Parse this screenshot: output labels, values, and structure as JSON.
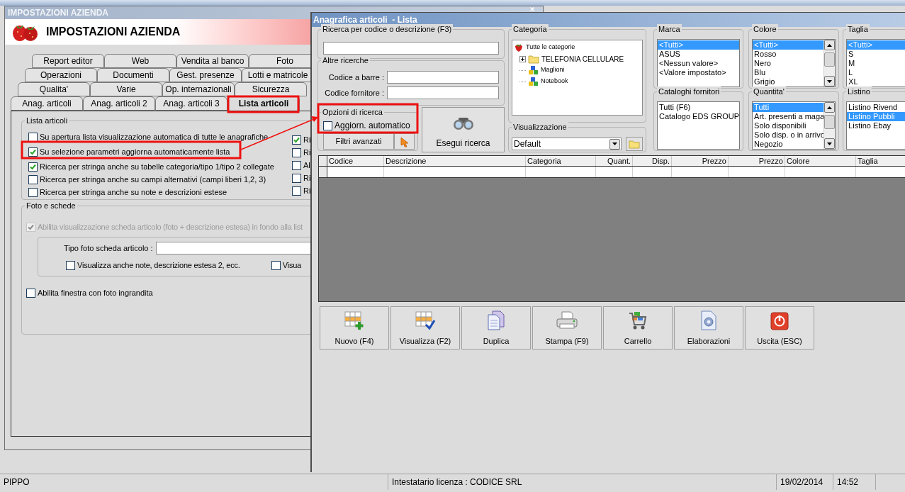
{
  "settings_window": {
    "title": "IMPOSTAZIONI AZIENDA",
    "header_title": "IMPOSTAZIONI AZIENDA",
    "tab_rows": [
      [
        {
          "label": "Report editor",
          "selected": false
        },
        {
          "label": "Web",
          "selected": false
        },
        {
          "label": "Vendita al banco",
          "selected": false
        },
        {
          "label": "Foto",
          "selected": false
        }
      ],
      [
        {
          "label": "Operazioni",
          "selected": false
        },
        {
          "label": "Documenti",
          "selected": false
        },
        {
          "label": "Gest. presenze",
          "selected": false
        },
        {
          "label": "Lotti e matricole",
          "selected": false
        }
      ],
      [
        {
          "label": "Qualita'",
          "selected": false
        },
        {
          "label": "Varie",
          "selected": false
        },
        {
          "label": "Op. internazionali",
          "selected": false
        },
        {
          "label": "Sicurezza",
          "selected": false
        }
      ],
      [
        {
          "label": "Anag. articoli",
          "selected": false
        },
        {
          "label": "Anag. articoli 2",
          "selected": false
        },
        {
          "label": "Anag. articoli 3",
          "selected": false
        },
        {
          "label": "Lista articoli",
          "selected": true
        }
      ]
    ],
    "list_group": {
      "legend": "Lista articoli",
      "options": [
        {
          "label": "Su apertura lista visualizzazione automatica di tutte le anagrafiche",
          "checked": false
        },
        {
          "label": "Su selezione parametri aggiorna automaticamente lista",
          "checked": true
        },
        {
          "label": "Ricerca per stringa anche su tabelle categoria/tipo 1/tipo 2 collegate",
          "checked": true
        },
        {
          "label": "Ricerca per stringa anche su campi alternativi (campi liberi 1,2, 3)",
          "checked": false
        },
        {
          "label": "Ricerca per stringa anche su note e descrizioni estese",
          "checked": false
        }
      ],
      "side_options": [
        {
          "label": "Ri",
          "checked": true
        },
        {
          "label": "Ri",
          "checked": false
        },
        {
          "label": "Al",
          "checked": false
        },
        {
          "label": "Ri",
          "checked": false
        },
        {
          "label": "Ri",
          "checked": false
        }
      ]
    },
    "photo_group": {
      "legend": "Foto e schede",
      "option": {
        "label": "Abilita visualizzazione scheda articolo (foto + descrizione estesa) in fondo alla list",
        "checked": true,
        "disabled": true
      },
      "photo_type": {
        "label": "Tipo foto scheda articolo :"
      },
      "sub_options": [
        {
          "label": "Visualizza anche note, descrizione estesa 2, ecc.",
          "checked": false
        },
        {
          "label": "Visua",
          "checked": false
        }
      ],
      "enlarged_photo_option": {
        "label": "Abilita finestra con foto ingrandita",
        "checked": false
      }
    }
  },
  "list_window": {
    "title": "Anagrafica articoli  - Lista",
    "search_group": {
      "legend": "Ricerca per codice o descrizione (F3)"
    },
    "other_search": {
      "legend": "Altre ricerche",
      "fields": [
        {
          "label": "Codice a barre :"
        },
        {
          "label": "Codice fornitore :"
        }
      ]
    },
    "options_group": {
      "legend": "Opzioni di ricerca",
      "auto_update": {
        "label": "Aggiorn. automatico",
        "checked": false
      },
      "advanced_button": "Filtri avanzati"
    },
    "search_button": "Esegui ricerca",
    "category": {
      "legend": "Categoria",
      "tree": [
        {
          "label": "Tutte le categorie",
          "kind": "root",
          "children": [
            {
              "label": "TELEFONIA CELLULARE",
              "kind": "folder",
              "expanded": false
            },
            {
              "label": "Maglioni",
              "kind": "item"
            },
            {
              "label": "Notebook",
              "kind": "item"
            }
          ]
        }
      ]
    },
    "view": {
      "legend": "Visualizzazione",
      "value": "Default"
    },
    "filter_columns": [
      [
        {
          "legend": "Marca",
          "scrollbar": false,
          "items": [
            {
              "text": "<Tutti>",
              "selected": true
            },
            {
              "text": "ASUS",
              "selected": false
            },
            {
              "text": "<Nessun valore>",
              "selected": false
            },
            {
              "text": "<Valore impostato>",
              "selected": false
            }
          ]
        },
        {
          "legend": "Cataloghi fornitori",
          "scrollbar": false,
          "items": [
            {
              "text": "Tutti (F6)",
              "selected": false
            },
            {
              "text": "Catalogo EDS GROUP",
              "selected": false
            }
          ]
        }
      ],
      [
        {
          "legend": "Colore",
          "scrollbar": true,
          "items": [
            {
              "text": "<Tutti>",
              "selected": true
            },
            {
              "text": "Rosso",
              "selected": false
            },
            {
              "text": "Nero",
              "selected": false
            },
            {
              "text": "Blu",
              "selected": false
            },
            {
              "text": "Grigio",
              "selected": false
            }
          ]
        },
        {
          "legend": "Quantita'",
          "scrollbar": true,
          "items": [
            {
              "text": "Tutti",
              "selected": true
            },
            {
              "text": "Art. presenti a maga",
              "selected": false
            },
            {
              "text": "Solo disponibili",
              "selected": false
            },
            {
              "text": "Solo disp. o in arrivo",
              "selected": false
            },
            {
              "text": "Negozio",
              "selected": false
            }
          ]
        }
      ],
      [
        {
          "legend": "Taglia",
          "scrollbar": false,
          "items": [
            {
              "text": "<Tutti>",
              "selected": true
            },
            {
              "text": "S",
              "selected": false
            },
            {
              "text": "M",
              "selected": false
            },
            {
              "text": "L",
              "selected": false
            },
            {
              "text": "XL",
              "selected": false
            }
          ]
        },
        {
          "legend": "Listino",
          "scrollbar": false,
          "items": [
            {
              "text": "Listino Rivend",
              "selected": false
            },
            {
              "text": "Listino Pubbli",
              "selected": true
            },
            {
              "text": "Listino Ebay",
              "selected": false
            }
          ]
        }
      ]
    ],
    "table_columns": [
      {
        "label": "Codice"
      },
      {
        "label": "Descrizione"
      },
      {
        "label": "Categoria"
      },
      {
        "label": "Quant."
      },
      {
        "label": "Disp."
      },
      {
        "label": "Prezzo"
      },
      {
        "label": "Prezzo"
      },
      {
        "label": "Colore"
      },
      {
        "label": "Taglia"
      }
    ],
    "buttons": [
      {
        "label": "Nuovo (F4)",
        "kind": "new"
      },
      {
        "label": "Visualizza (F2)",
        "kind": "view"
      },
      {
        "label": "Duplica",
        "kind": "duplicate"
      },
      {
        "label": "Stampa (F9)",
        "kind": "print"
      },
      {
        "label": "Carrello",
        "kind": "cart"
      },
      {
        "label": "Elaborazioni",
        "kind": "process"
      },
      {
        "label": "Uscita (ESC)",
        "kind": "exit"
      }
    ]
  },
  "status_bar": {
    "user": "PIPPO",
    "license": "Intestatario licenza : CODICE SRL",
    "date": "19/02/2014",
    "time": "14:52"
  }
}
